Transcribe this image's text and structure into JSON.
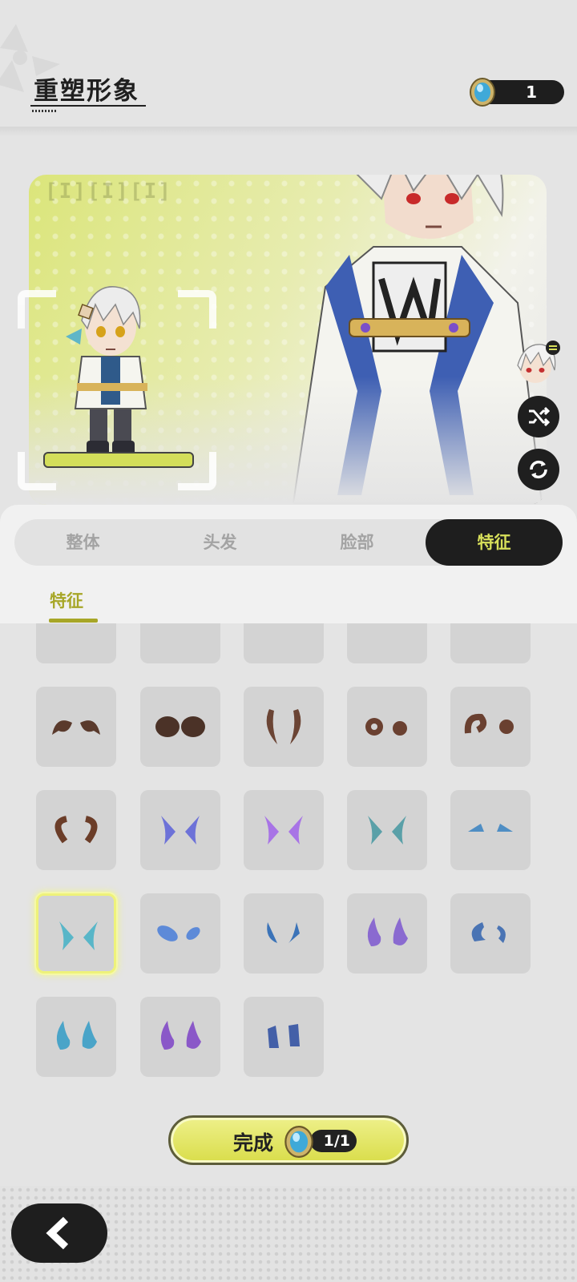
{
  "header": {
    "title": "重塑形象",
    "currency_value": "1"
  },
  "stage": {
    "label": "[I][I][I]"
  },
  "tabs": [
    {
      "label": "整体",
      "active": false
    },
    {
      "label": "头发",
      "active": false
    },
    {
      "label": "脸部",
      "active": false
    },
    {
      "label": "特征",
      "active": true
    }
  ],
  "subtabs": [
    {
      "label": "特征",
      "active": true
    }
  ],
  "features": {
    "selected_index": 15,
    "items": [
      {
        "icon": "item-partial-icon"
      },
      {
        "icon": "item-partial-icon"
      },
      {
        "icon": "item-partial-icon"
      },
      {
        "icon": "item-partial-icon"
      },
      {
        "icon": "item-partial-icon"
      },
      {
        "icon": "curled-horns-icon",
        "color": "#5a3a2c"
      },
      {
        "icon": "round-horns-icon",
        "color": "#4b3227"
      },
      {
        "icon": "long-horns-icon",
        "color": "#6b4434"
      },
      {
        "icon": "spiral-horns-icon",
        "color": "#6a4030"
      },
      {
        "icon": "ram-horns-icon",
        "color": "#6a4030"
      },
      {
        "icon": "hook-horns-icon",
        "color": "#6b3d28"
      },
      {
        "icon": "wings-icon",
        "color": "#6d72d8"
      },
      {
        "icon": "wings-icon",
        "color": "#a874e6"
      },
      {
        "icon": "wings-icon",
        "color": "#5aa0a8"
      },
      {
        "icon": "small-wings-icon",
        "color": "#4f8ec4"
      },
      {
        "icon": "wings-icon",
        "color": "#58b6c8"
      },
      {
        "icon": "leaf-wings-icon",
        "color": "#5d8ad8"
      },
      {
        "icon": "feather-icon",
        "color": "#3b73b8"
      },
      {
        "icon": "flame-horns-icon",
        "color": "#8a6ad0"
      },
      {
        "icon": "claw-horns-icon",
        "color": "#4a74b4"
      },
      {
        "icon": "flame-horns-icon",
        "color": "#4aa4c8"
      },
      {
        "icon": "flame-horns-icon",
        "color": "#8a58c8"
      },
      {
        "icon": "crystal-horns-icon",
        "color": "#4460a8"
      }
    ]
  },
  "done_button": {
    "label": "完成",
    "cost": "1/1"
  }
}
